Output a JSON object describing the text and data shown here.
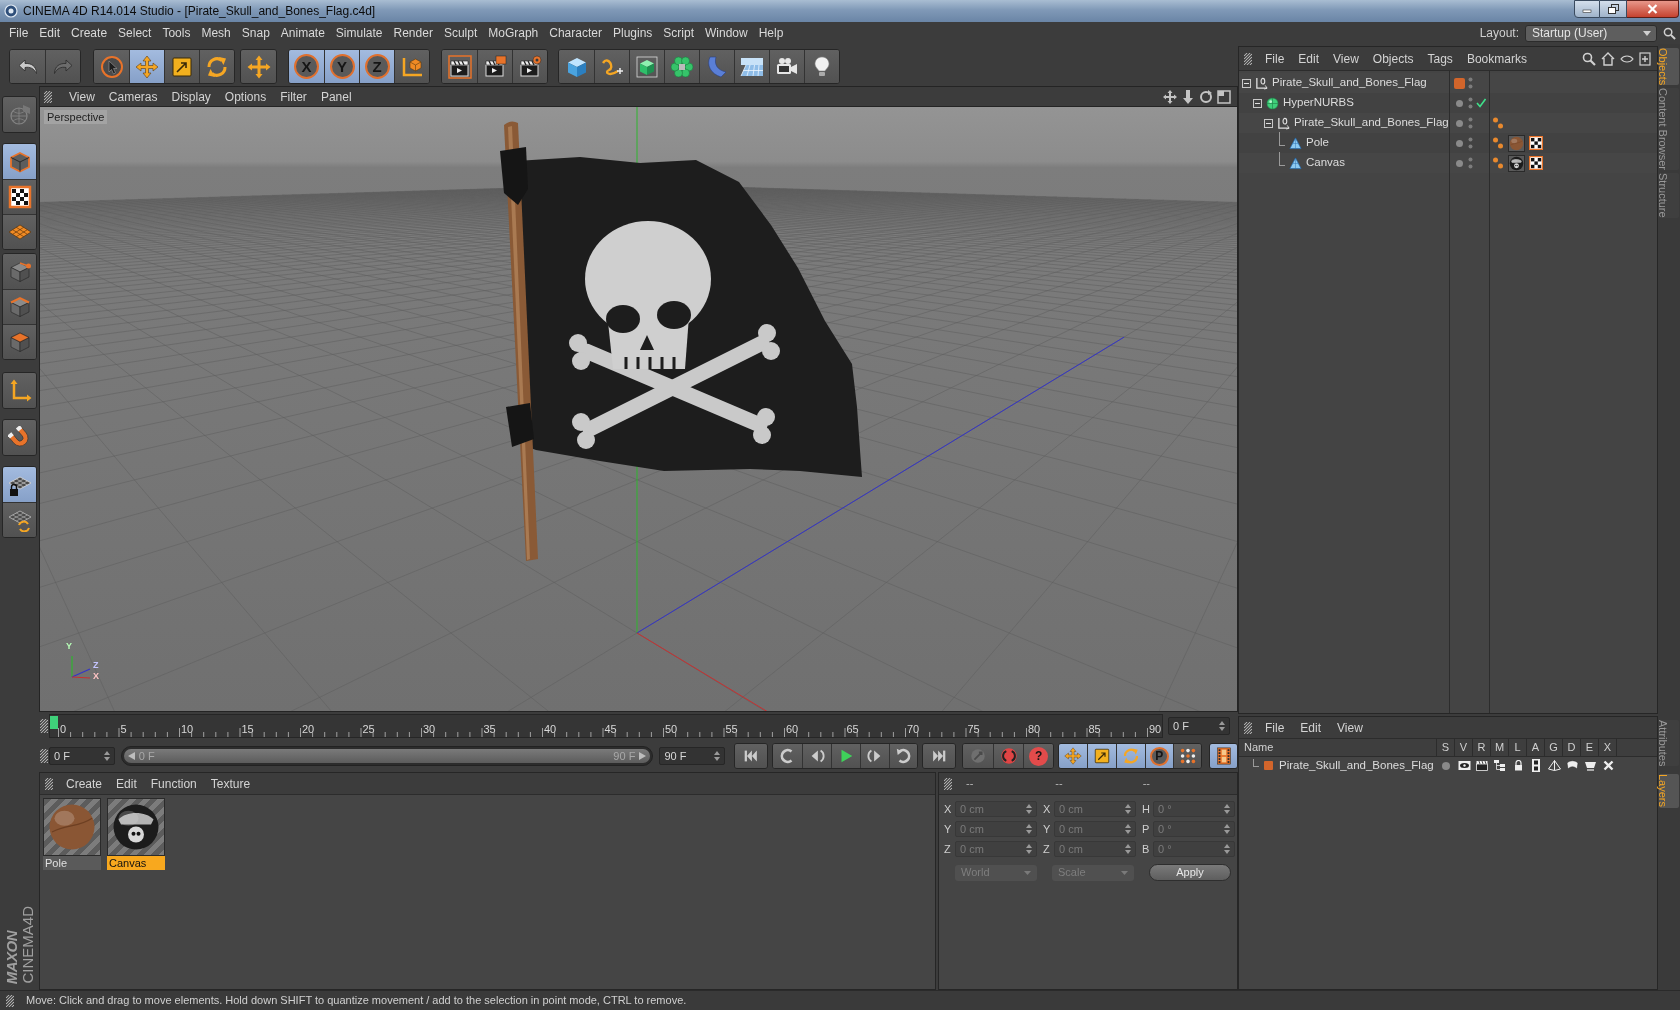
{
  "window": {
    "title": "CINEMA 4D R14.014 Studio - [Pirate_Skull_and_Bones_Flag.c4d]"
  },
  "menu_bar": {
    "items": [
      "File",
      "Edit",
      "Create",
      "Select",
      "Tools",
      "Mesh",
      "Snap",
      "Animate",
      "Simulate",
      "Render",
      "Sculpt",
      "MoGraph",
      "Character",
      "Plugins",
      "Script",
      "Window",
      "Help"
    ],
    "layout_label": "Layout:",
    "layout_value": "Startup (User)"
  },
  "toolbar": {
    "groups": [
      [
        {
          "kind": "undo",
          "disabled": false
        },
        {
          "kind": "redo",
          "disabled": true
        }
      ],
      [
        {
          "kind": "select",
          "selected": false
        },
        {
          "kind": "move",
          "selected": true
        },
        {
          "kind": "scale",
          "selected": false
        },
        {
          "kind": "rotate",
          "selected": false
        }
      ],
      [
        {
          "kind": "transform",
          "selected": false
        }
      ],
      [
        {
          "kind": "axis",
          "label": "X",
          "selected": true
        },
        {
          "kind": "axis",
          "label": "Y",
          "selected": true
        },
        {
          "kind": "axis",
          "label": "Z",
          "selected": true
        },
        {
          "kind": "coords",
          "selected": false
        }
      ],
      [
        {
          "kind": "render_view"
        },
        {
          "kind": "render_picture"
        },
        {
          "kind": "render_settings"
        }
      ],
      [
        {
          "kind": "cube"
        },
        {
          "kind": "spline"
        },
        {
          "kind": "subdivision"
        },
        {
          "kind": "array"
        },
        {
          "kind": "deformer"
        },
        {
          "kind": "floor"
        },
        {
          "kind": "camera"
        },
        {
          "kind": "light"
        }
      ]
    ]
  },
  "left_toolbar": {
    "groups": [
      [
        {
          "kind": "convert",
          "disabled": true
        }
      ],
      [
        {
          "kind": "model",
          "selected": true
        },
        {
          "kind": "texture",
          "selected": false
        },
        {
          "kind": "workplane",
          "selected": false
        }
      ],
      [
        {
          "kind": "points",
          "selected": false
        },
        {
          "kind": "edges",
          "selected": false
        },
        {
          "kind": "polygons",
          "selected": false
        }
      ],
      [
        {
          "kind": "axis_mode",
          "selected": false
        }
      ],
      [
        {
          "kind": "snap",
          "selected": false
        }
      ],
      [
        {
          "kind": "lock_workplane",
          "selected": true
        },
        {
          "kind": "align_workplane",
          "selected": false
        }
      ]
    ]
  },
  "viewport": {
    "menu": [
      "View",
      "Cameras",
      "Display",
      "Options",
      "Filter",
      "Panel"
    ],
    "label": "Perspective",
    "axis_labels": [
      "Y",
      "Z",
      "X"
    ]
  },
  "object_manager": {
    "menu": [
      "File",
      "Edit",
      "View",
      "Objects",
      "Tags",
      "Bookmarks"
    ],
    "objects": [
      {
        "name": "Pirate_Skull_and_Bones_Flag",
        "kind": "null",
        "expanded": true,
        "color": "#d2652b",
        "children": [
          {
            "name": "HyperNURBS",
            "kind": "hypernurbs",
            "expanded": true,
            "enabled": true,
            "children": [
              {
                "name": "Pirate_Skull_and_Bones_Flag",
                "kind": "null",
                "expanded": true,
                "tags": [
                  {
                    "kind": "phong"
                  }
                ],
                "children": [
                  {
                    "name": "Pole",
                    "kind": "polygon",
                    "tags": [
                      {
                        "kind": "phong"
                      },
                      {
                        "kind": "material",
                        "color": "#8a5634",
                        "emblem": false
                      },
                      {
                        "kind": "uvw"
                      }
                    ]
                  },
                  {
                    "name": "Canvas",
                    "kind": "polygon",
                    "tags": [
                      {
                        "kind": "phong"
                      },
                      {
                        "kind": "material",
                        "color": "#1c1c1c",
                        "emblem": true
                      },
                      {
                        "kind": "uvw"
                      }
                    ]
                  }
                ]
              }
            ]
          }
        ]
      }
    ]
  },
  "side_tabs": {
    "top": [
      {
        "label": "Objects",
        "selected": true
      },
      {
        "label": "Content Browser",
        "selected": false
      },
      {
        "label": "Structure",
        "selected": false
      }
    ],
    "bottom": [
      {
        "label": "Attributes",
        "selected": false
      },
      {
        "label": "Layers",
        "selected": true
      }
    ]
  },
  "timeline": {
    "ticks": [
      "0",
      "5",
      "10",
      "15",
      "20",
      "25",
      "30",
      "35",
      "40",
      "45",
      "50",
      "55",
      "60",
      "65",
      "70",
      "75",
      "80",
      "85",
      "90"
    ],
    "playhead": {
      "level": 0
    },
    "current_frame": "0 F"
  },
  "transport": {
    "start_frame": "0 F",
    "range": {
      "start": "0 F",
      "end": "90 F",
      "level": 1
    },
    "end_frame": "90 F",
    "groups": [
      [
        {
          "kind": "go_start"
        }
      ],
      [
        {
          "kind": "prev_key"
        },
        {
          "kind": "prev_frame"
        },
        {
          "kind": "play"
        },
        {
          "kind": "next_frame"
        },
        {
          "kind": "next_key"
        }
      ],
      [
        {
          "kind": "go_end"
        }
      ],
      [
        {
          "kind": "record",
          "disabled": true
        },
        {
          "kind": "autokey",
          "disabled": false
        },
        {
          "kind": "key_help",
          "label": "?",
          "disabled": false
        }
      ],
      [
        {
          "kind": "key_move",
          "selected": true
        },
        {
          "kind": "key_scale",
          "selected": true
        },
        {
          "kind": "key_rotate",
          "selected": true
        },
        {
          "kind": "param",
          "label": "P",
          "selected": true
        },
        {
          "kind": "pla",
          "selected": false
        }
      ],
      [
        {
          "kind": "timeline",
          "selected": true
        }
      ]
    ]
  },
  "layer_manager": {
    "menu": [
      "File",
      "Edit",
      "View"
    ],
    "columns": [
      "Name",
      "S",
      "V",
      "R",
      "M",
      "L",
      "A",
      "G",
      "D",
      "E",
      "X"
    ],
    "layers": [
      {
        "name": "Pirate_Skull_and_Bones_Flag",
        "color": "#d2652b",
        "flags": [
          {
            "kind": "solo",
            "on": false
          },
          {
            "kind": "view",
            "on": true
          },
          {
            "kind": "render",
            "on": true
          },
          {
            "kind": "manager",
            "on": true
          },
          {
            "kind": "lock",
            "on": true
          },
          {
            "kind": "animation",
            "on": true
          },
          {
            "kind": "generators",
            "on": true
          },
          {
            "kind": "deformers",
            "on": true
          },
          {
            "kind": "expressions",
            "on": true
          },
          {
            "kind": "xref",
            "on": true
          }
        ]
      }
    ]
  },
  "material_manager": {
    "menu": [
      "Create",
      "Edit",
      "Function",
      "Texture"
    ],
    "materials": [
      {
        "name": "Pole",
        "color": "#8a5634",
        "emblem": false,
        "selected": false
      },
      {
        "name": "Canvas",
        "color": "#1c1c1c",
        "emblem": true,
        "selected": true
      }
    ]
  },
  "coordinates": {
    "headers": [
      "--",
      "--",
      "--"
    ],
    "rows": [
      [
        {
          "label": "X",
          "value": "0 cm",
          "disabled": true
        },
        {
          "label": "X",
          "value": "0 cm",
          "disabled": true
        },
        {
          "label": "H",
          "value": "0 °",
          "disabled": true
        }
      ],
      [
        {
          "label": "Y",
          "value": "0 cm",
          "disabled": true
        },
        {
          "label": "Y",
          "value": "0 cm",
          "disabled": true
        },
        {
          "label": "P",
          "value": "0 °",
          "disabled": true
        }
      ],
      [
        {
          "label": "Z",
          "value": "0 cm",
          "disabled": true
        },
        {
          "label": "Z",
          "value": "0 cm",
          "disabled": true
        },
        {
          "label": "B",
          "value": "0 °",
          "disabled": true
        }
      ]
    ],
    "dropdowns": [
      {
        "value": "World",
        "disabled": true
      },
      {
        "value": "Scale",
        "disabled": true
      }
    ],
    "apply": "Apply"
  },
  "logo": {
    "brand": "MAXON",
    "product": "CINEMA4D"
  },
  "status_bar": {
    "text": "Move: Click and drag to move elements. Hold down SHIFT to quantize movement / add to the selection in point mode, CTRL to remove."
  }
}
